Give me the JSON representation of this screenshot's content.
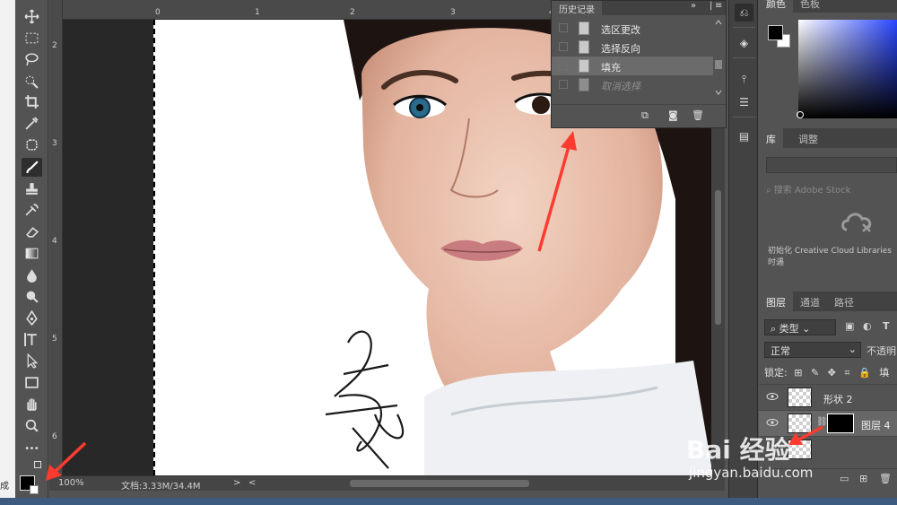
{
  "left_strip": {
    "cut_text": "成"
  },
  "rulers": {
    "top": [
      "0",
      "1",
      "2",
      "3",
      "4"
    ],
    "left": [
      "2",
      "3",
      "4",
      "5",
      "6"
    ]
  },
  "status": {
    "zoom": "100%",
    "doc_info": "文档:3.33M/34.4M",
    "arrow_right": ">",
    "arrow_left": "<"
  },
  "history": {
    "title": "历史记录",
    "items": [
      {
        "label": "选区更改",
        "state": "normal"
      },
      {
        "label": "选择反向",
        "state": "normal"
      },
      {
        "label": "填充",
        "state": "selected"
      },
      {
        "label": "取消选择",
        "state": "undone"
      }
    ]
  },
  "color_panel": {
    "tab_color": "颜色",
    "tab_swatches": "色板"
  },
  "library_panel": {
    "tab_library": "库",
    "tab_adjust": "调整",
    "search_placeholder": "搜索 Adobe Stock",
    "message": "初始化 Creative Cloud Libraries 时遇"
  },
  "layers_panel": {
    "tab_layers": "图层",
    "tab_channels": "通道",
    "tab_paths": "路径",
    "filter_kind": "类型",
    "blend_mode": "正常",
    "opacity_label": "不透明",
    "lock_label": "锁定:",
    "fill_label": "填",
    "layers": [
      {
        "name": "形状 2",
        "selected": false
      },
      {
        "name": "图层 4",
        "selected": true
      }
    ]
  },
  "watermark": {
    "brand": "Bai  经验",
    "url": "jingyan.baidu.com"
  },
  "colors": {
    "accent_arrow": "#ff3b30",
    "panel": "#535353",
    "dark": "#282828"
  }
}
